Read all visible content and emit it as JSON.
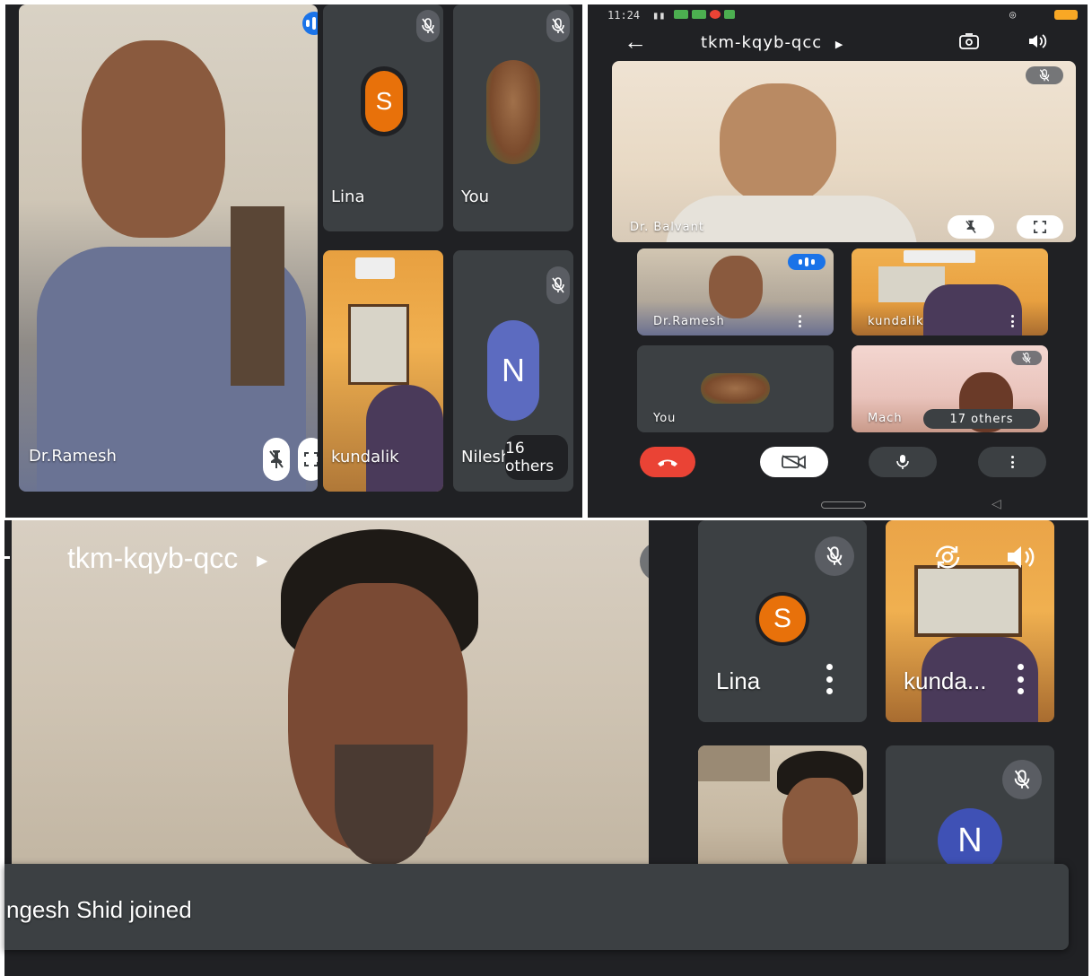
{
  "panel_a": {
    "main_tile_name": "Dr.Ramesh",
    "tiles": [
      {
        "name": "Lina",
        "avatar_letter": "S",
        "avatar_color": "#e8710a"
      },
      {
        "name": "You"
      },
      {
        "name": "kundalik"
      },
      {
        "name": "Nilesh",
        "avatar_letter": "N",
        "avatar_color": "#5c6bc0"
      }
    ],
    "others_label": "16 others"
  },
  "panel_b": {
    "status_time": "11:24",
    "meeting_code": "tkm-kqyb-qcc",
    "main_tile_name": "Dr. Balvant",
    "tiles": [
      {
        "name": "Dr.Ramesh"
      },
      {
        "name": "kundalik"
      },
      {
        "name": "You"
      },
      {
        "name": "Mach"
      }
    ],
    "others_label": "17 others",
    "colors": {
      "end_call": "#ea4335",
      "toolbar_bg": "#202124"
    }
  },
  "panel_c": {
    "meeting_code": "tkm-kqyb-qcc",
    "tiles": [
      {
        "name": "Lina",
        "avatar_letter": "S",
        "avatar_color": "#e8710a"
      },
      {
        "name": "kunda..."
      },
      {
        "name": ""
      },
      {
        "name": "",
        "avatar_letter": "N",
        "avatar_color": "#3f51b5"
      }
    ],
    "toast": "ngesh Shid joined"
  },
  "icons": [
    "mic-off-icon",
    "pin-icon",
    "fullscreen-icon",
    "back-arrow-icon",
    "switch-camera-icon",
    "speaker-icon",
    "end-call-icon",
    "camera-off-icon",
    "mic-icon",
    "more-options-icon",
    "speaking-indicator-icon"
  ]
}
